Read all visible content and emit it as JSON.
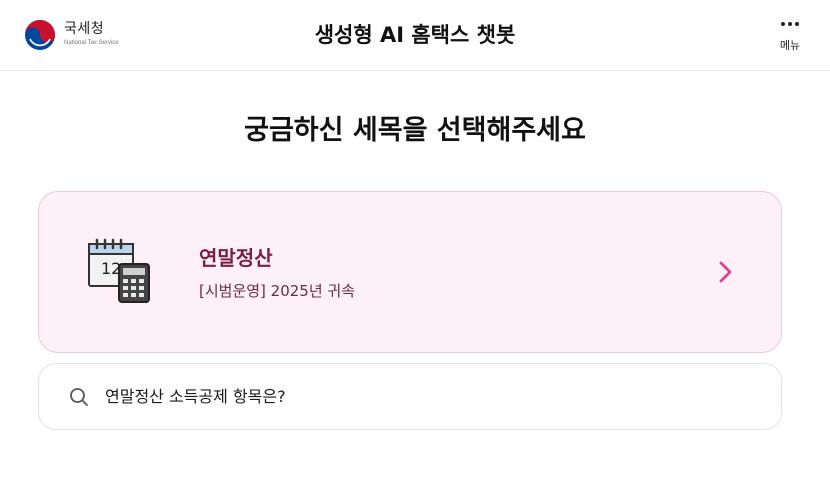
{
  "header": {
    "logo_name": "국세청",
    "logo_sub": "National Tax Service",
    "title": "생성형 AI 홈택스 챗봇",
    "menu_label": "메뉴",
    "menu_icon": "more-dots-icon"
  },
  "main": {
    "heading": "궁금하신 세목을 선택해주세요",
    "topic_card": {
      "title": "연말정산",
      "subtitle": "[시범운영] 2025년 귀속",
      "calendar_day": "12",
      "icon": "calendar-calculator-icon",
      "chevron_icon": "chevron-right-icon"
    },
    "question": {
      "text": "연말정산 소득공제 항목은?",
      "icon": "search-icon"
    }
  },
  "colors": {
    "card_bg": "#fdf0f6",
    "card_border": "#f3c6da",
    "card_title": "#7a1e45",
    "accent_chevron": "#e0418a",
    "logo_red": "#c8102e",
    "logo_blue": "#0047a0"
  }
}
